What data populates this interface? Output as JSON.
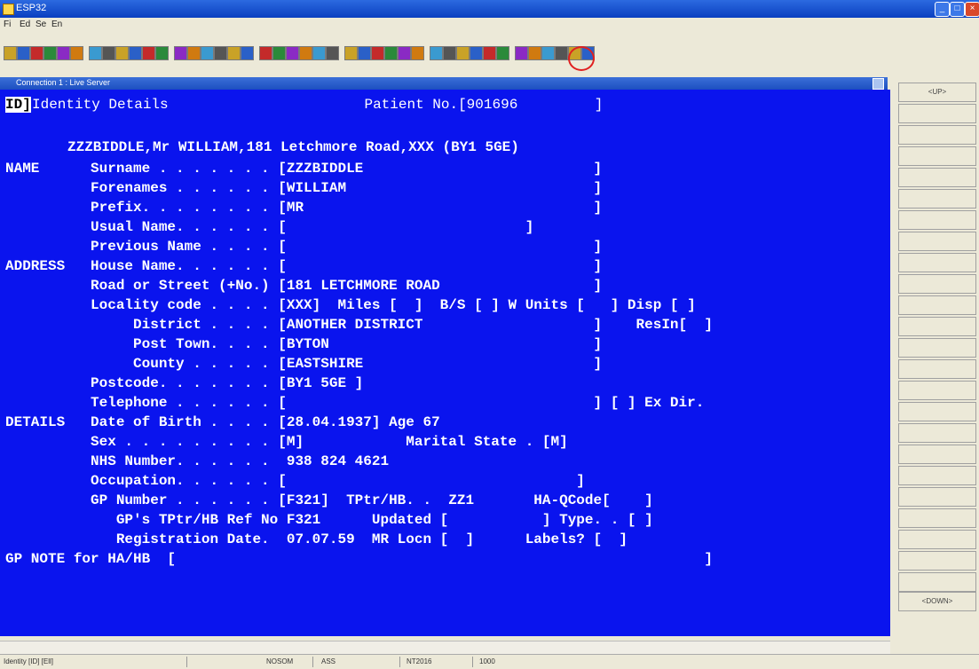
{
  "window": {
    "title": "ESP32",
    "min": "_",
    "max": "□",
    "close": "×"
  },
  "menu": [
    "Fi",
    "Ed",
    "Se",
    "En"
  ],
  "connection": {
    "title": "Connection 1 : Live Server"
  },
  "side_buttons": {
    "up": "<UP>",
    "down": "<DOWN>"
  },
  "terminal": {
    "lines": [
      {
        "key": "l0a",
        "text": "ID]",
        "box": true
      },
      {
        "key": "l0b",
        "text": "Identity Details                       Patient No.[901696         ]"
      },
      {
        "key": "l2",
        "text": "ZZZBIDDLE,Mr WILLIAM,181 Letchmore Road,XXX (BY1 5GE)",
        "bold": true
      },
      {
        "key": "l3",
        "text": "NAME      Surname . . . . . . . [ZZZBIDDLE                           ]",
        "bold": true
      },
      {
        "key": "l4",
        "text": "          Forenames . . . . . . [WILLIAM                             ]",
        "bold": true
      },
      {
        "key": "l5",
        "text": "          Prefix. . . . . . . . [MR                                  ]",
        "bold": true
      },
      {
        "key": "l6",
        "text": "          Usual Name. . . . . . [                            ]",
        "bold": true
      },
      {
        "key": "l7",
        "text": "          Previous Name . . . . [                                    ]",
        "bold": true
      },
      {
        "key": "l8",
        "text": "ADDRESS   House Name. . . . . . [                                    ]",
        "bold": true
      },
      {
        "key": "l9",
        "text": "          Road or Street (+No.) [181 LETCHMORE ROAD                  ]",
        "bold": true
      },
      {
        "key": "l10",
        "text": "          Locality code . . . . [XXX]  Miles [  ]  B/S [ ] W Units [   ] Disp [ ]",
        "bold": true
      },
      {
        "key": "l11",
        "text": "               District . . . . [ANOTHER DISTRICT                    ]    ResIn[  ]",
        "bold": true
      },
      {
        "key": "l12",
        "text": "               Post Town. . . . [BYTON                               ]",
        "bold": true
      },
      {
        "key": "l13",
        "text": "               County . . . . . [EASTSHIRE                           ]",
        "bold": true
      },
      {
        "key": "l14",
        "text": "          Postcode. . . . . . . [BY1 5GE ]",
        "bold": true
      },
      {
        "key": "l15",
        "text": "          Telephone . . . . . . [                                    ] [ ] Ex Dir.",
        "bold": true
      },
      {
        "key": "l16",
        "text": "DETAILS   Date of Birth . . . . [28.04.1937] Age 67",
        "bold": true
      },
      {
        "key": "l17",
        "text": "          Sex . . . . . . . . . [M]            Marital State . [M]",
        "bold": true
      },
      {
        "key": "l18",
        "text": "          NHS Number. . . . . .  938 824 4621",
        "bold": true
      },
      {
        "key": "l19",
        "text": "          Occupation. . . . . . [                                  ]",
        "bold": true
      },
      {
        "key": "l20",
        "text": "          GP Number . . . . . . [F321]  TPtr/HB. .  ZZ1       HA-QCode[    ]",
        "bold": true
      },
      {
        "key": "l21",
        "text": "             GP's TPtr/HB Ref No F321      Updated [           ] Type. . [ ]",
        "bold": true
      },
      {
        "key": "l22",
        "text": "             Registration Date.  07.07.59  MR Locn [  ]      Labels? [  ]",
        "bold": true
      },
      {
        "key": "l23",
        "text": "GP NOTE for HA/HB  [                                                              ]",
        "bold": true
      }
    ]
  },
  "status": {
    "s1": "Identity  [ID]  [Ell]",
    "s2": "NOSOM",
    "s3": "ASS",
    "s4": "NT2016",
    "s5": "1000"
  }
}
